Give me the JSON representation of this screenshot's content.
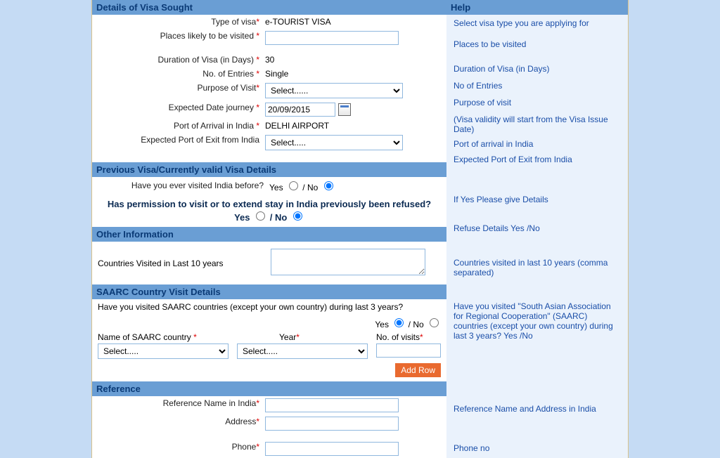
{
  "sections": {
    "visa": "Details of Visa Sought",
    "prev": "Previous Visa/Currently valid Visa Details",
    "other": "Other Information",
    "saarc": "SAARC Country Visit Details",
    "ref": "Reference",
    "help": "Help"
  },
  "visa": {
    "type_label": "Type of visa",
    "type_value": "e-TOURIST VISA",
    "places_label": "Places likely to be visited ",
    "duration_label": "Duration of Visa (in Days) ",
    "duration_value": "30",
    "entries_label": "No. of Entries ",
    "entries_value": "Single",
    "purpose_label": "Purpose of Visit",
    "purpose_value": "Select......",
    "expdate_label": "Expected Date journey ",
    "expdate_value": "20/09/2015",
    "porta_label": "Port of Arrival in India ",
    "porta_value": "DELHI AIRPORT",
    "porte_label": "Expected Port of Exit from India",
    "porte_value": "Select....."
  },
  "prev": {
    "visited_label": "Have you ever visited India before?",
    "yes": "Yes",
    "no": "No",
    "slash": " / ",
    "perm_q": "Has permission to visit or to extend stay in India previously been refused?"
  },
  "other": {
    "countries_label": "Countries Visited in Last 10 years"
  },
  "saarc": {
    "q": "Have you visited SAARC countries (except your own country) during last 3 years?",
    "yes": "Yes",
    "no": "No",
    "slash": " / ",
    "name_label": "Name of SAARC country ",
    "year_label": "Year",
    "visits_label": "No. of visits",
    "select": "Select.....",
    "add_row": "Add Row"
  },
  "ref": {
    "name_label": "Reference Name in India",
    "addr_label": "Address",
    "phone_label": "Phone"
  },
  "help": {
    "type": "Select visa type you are applying for",
    "places": "Places to be visited",
    "duration": "Duration of Visa (in Days)",
    "entries": "No of Entries",
    "purpose": "Purpose of visit",
    "expdate": "(Visa validity will start from the Visa Issue Date)",
    "porta": "Port of arrival in India",
    "porte": "Expected Port of Exit from India",
    "visited": "If Yes Please give Details",
    "refuse": "Refuse Details Yes /No",
    "countries": "Countries visited in last 10 years (comma separated)",
    "saarc": "Have you visited \"South Asian Association for Regional Cooperation\" (SAARC) countries (except your own country) during last 3 years? Yes /No",
    "refname": "Reference Name and Address in India",
    "phone": "Phone no"
  }
}
